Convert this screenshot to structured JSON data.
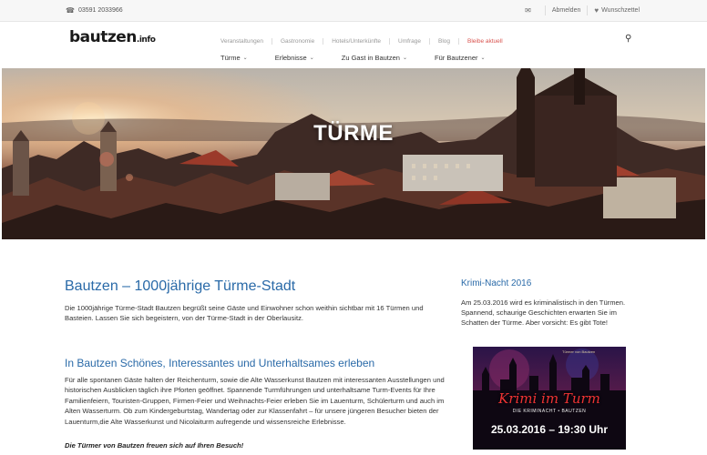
{
  "topbar": {
    "phone": "03591 2033966",
    "logout": "Abmelden",
    "wishlist": "Wunschzettel"
  },
  "logo": {
    "name": "bautzen",
    "tld": ".info"
  },
  "nav_top": [
    "Veranstaltungen",
    "Gastronomie",
    "Hotels/Unterkünfte",
    "Umfrage",
    "Blog",
    "Bleibe aktuell"
  ],
  "nav_main": [
    "Türme",
    "Erlebnisse",
    "Zu Gast in Bautzen",
    "Für Bautzener"
  ],
  "hero": {
    "title": "TÜRME"
  },
  "main": {
    "heading": "Bautzen – 1000jährige Türme-Stadt",
    "intro": "Die 1000jährige Türme-Stadt Bautzen begrüßt seine Gäste und Einwohner schon weithin sichtbar mit 16 Türmen und Basteien. Lassen Sie sich begeistern, von der Türme-Stadt in der Oberlausitz.",
    "subheading": "In Bautzen Schönes, Interessantes und Unterhaltsames erleben",
    "body": "Für alle spontanen Gäste halten der Reichenturm, sowie die Alte Wasserkunst Bautzen mit interessanten Ausstellungen und historischen Ausblicken täglich ihre Pforten geöffnet. Spannende Turmführungen und unterhaltsame Turm-Events für Ihre Familienfeiern, Touristen-Gruppen, Firmen-Feier und Weihnachts-Feier erleben Sie im Lauenturm, Schülerturm und auch im Alten Wasserturm. Ob zum Kindergeburtstag, Wandertag oder zur Klassenfahrt – für unsere jüngeren Besucher bieten der Lauenturm,die Alte Wasserkunst und Nicolaiturm aufregende und wissensreiche Erlebnisse.",
    "closing": "Die Türmer von Bautzen freuen sich auf Ihren Besuch!"
  },
  "sidebar": {
    "heading": "Krimi-Nacht 2016",
    "text": "Am 25.03.2016 wird es kriminalistisch in den Türmen. Spannend, schaurige Geschichten erwarten Sie im Schatten der Türme. Aber vorsicht: Es gibt Tote!",
    "poster": {
      "top": "Türmer von Bautzen",
      "title": "Krimi im Turm",
      "subtitle": "DIE KRIMINACHT • BAUTZEN",
      "date": "25.03.2016 – 19:30 Uhr"
    }
  },
  "icons": {
    "phone": "phone-icon",
    "mail": "mail-icon",
    "heart": "heart-icon",
    "search": "search-icon",
    "chevron": "chevron-down-icon"
  },
  "colors": {
    "heading_blue": "#2a6aa8",
    "accent_red": "#d9534f"
  }
}
